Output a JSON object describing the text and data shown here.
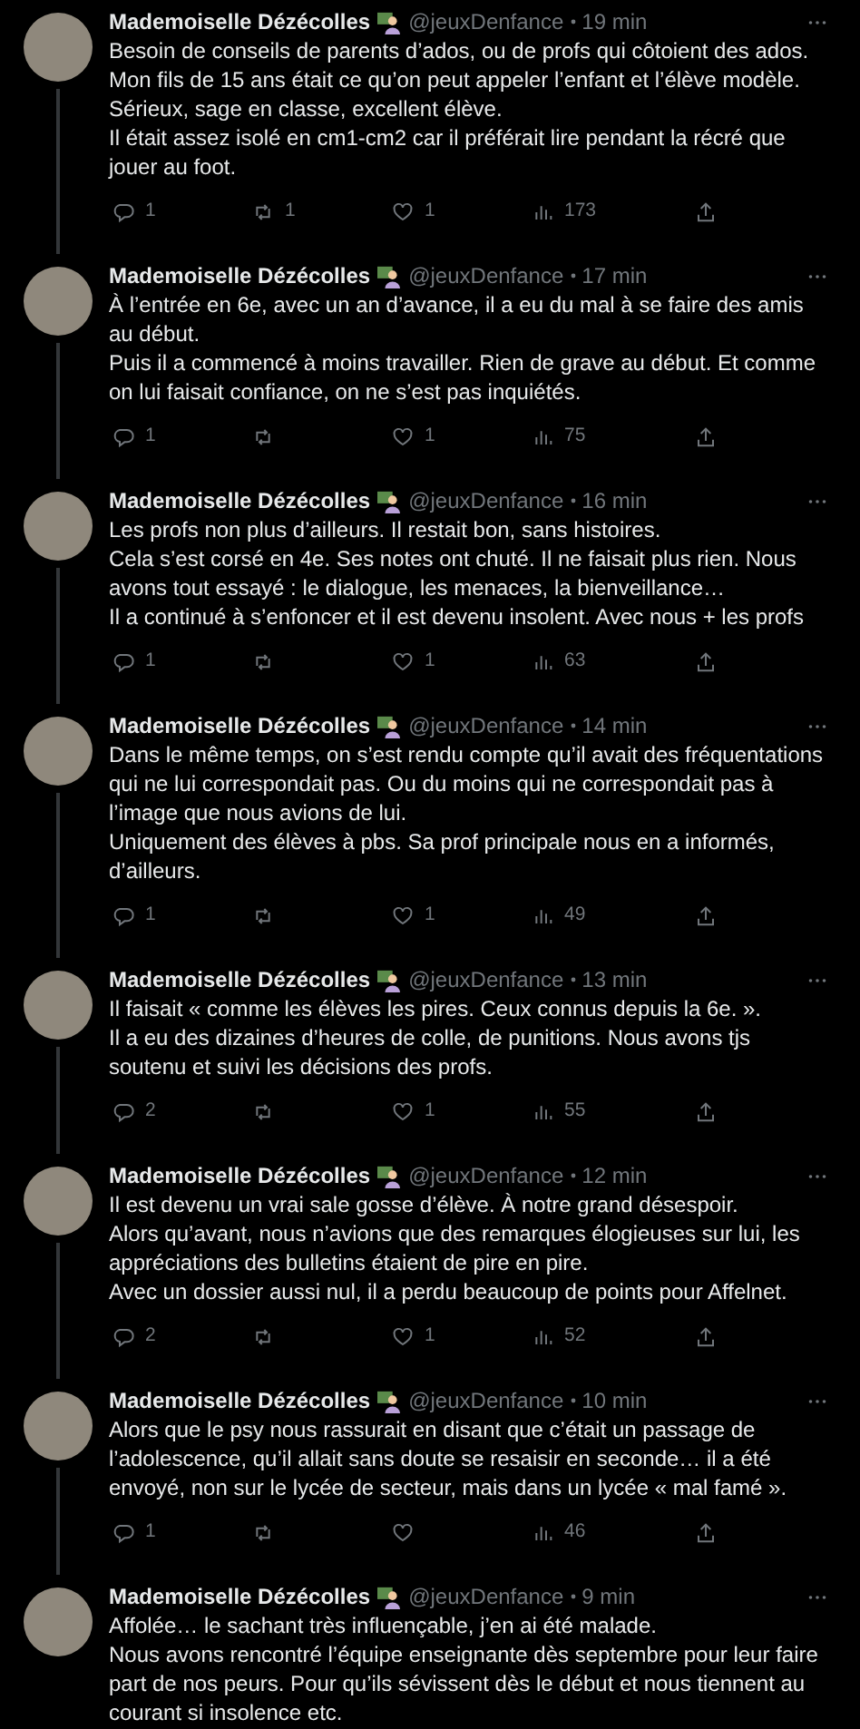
{
  "tweets": [
    {
      "author": "Mademoiselle Dézécolles",
      "handle": "@jeuxDenfance",
      "time": "19 min",
      "text": "Besoin de conseils de parents d’ados, ou de profs qui côtoient des ados.\nMon fils de 15 ans était ce qu’on peut appeler l’enfant et l’élève modèle.\nSérieux, sage en classe, excellent élève.\nIl était assez isolé en cm1-cm2 car il préférait lire pendant la récré que jouer au foot.",
      "stats": {
        "replies": "1",
        "retweets": "1",
        "likes": "1",
        "views": "173"
      }
    },
    {
      "author": "Mademoiselle Dézécolles",
      "handle": "@jeuxDenfance",
      "time": "17 min",
      "text": "À l’entrée en 6e, avec un an d’avance, il a eu du mal à se faire des amis au début.\nPuis il a commencé à moins travailler. Rien de grave au début. Et comme on lui faisait confiance, on ne s’est pas inquiétés.",
      "stats": {
        "replies": "1",
        "likes": "1",
        "views": "75"
      }
    },
    {
      "author": "Mademoiselle Dézécolles",
      "handle": "@jeuxDenfance",
      "time": "16 min",
      "text": "Les profs non plus d’ailleurs. Il restait bon, sans histoires.\nCela s’est corsé en 4e. Ses notes ont chuté. Il ne faisait plus rien. Nous avons tout essayé : le dialogue, les menaces, la bienveillance…\nIl a continué à s’enfoncer et il est devenu insolent. Avec nous + les profs",
      "stats": {
        "replies": "1",
        "likes": "1",
        "views": "63"
      }
    },
    {
      "author": "Mademoiselle Dézécolles",
      "handle": "@jeuxDenfance",
      "time": "14 min",
      "text": "Dans le même temps, on s’est rendu compte qu’il avait des fréquentations qui ne lui correspondait pas. Ou du moins qui ne correspondait pas à l’image que nous avions de lui.\nUniquement des élèves à pbs. Sa prof principale nous en a informés, d’ailleurs.",
      "stats": {
        "replies": "1",
        "likes": "1",
        "views": "49"
      }
    },
    {
      "author": "Mademoiselle Dézécolles",
      "handle": "@jeuxDenfance",
      "time": "13 min",
      "text": "Il faisait « comme les élèves les pires. Ceux connus depuis la 6e. ».\nIl a eu des dizaines d’heures de colle, de punitions. Nous avons tjs soutenu et suivi les décisions des profs.",
      "stats": {
        "replies": "2",
        "likes": "1",
        "views": "55"
      }
    },
    {
      "author": "Mademoiselle Dézécolles",
      "handle": "@jeuxDenfance",
      "time": "12 min",
      "text": "Il est devenu un vrai sale gosse d’élève. À notre grand désespoir.\nAlors qu’avant, nous n’avions que des remarques élogieuses sur lui, les appréciations des bulletins étaient de pire en pire.\nAvec un dossier aussi nul, il a perdu beaucoup de points pour Affelnet.",
      "stats": {
        "replies": "2",
        "likes": "1",
        "views": "52"
      }
    },
    {
      "author": "Mademoiselle Dézécolles",
      "handle": "@jeuxDenfance",
      "time": "10 min",
      "text": "Alors que le psy nous rassurait en disant que c’était un passage de l’adolescence, qu’il allait sans doute se resaisir en seconde… il a été envoyé, non sur le lycée de secteur, mais dans un lycée « mal famé ».",
      "stats": {
        "replies": "1",
        "views": "46"
      }
    },
    {
      "author": "Mademoiselle Dézécolles",
      "handle": "@jeuxDenfance",
      "time": "9 min",
      "text": "Affolée… le sachant très influençable, j’en ai été malade.\nNous avons rencontré l’équipe enseignante dès septembre pour leur faire part de nos peurs. Pour qu’ils sévissent dès le début et nous tiennent au courant si insolence etc."
    }
  ]
}
